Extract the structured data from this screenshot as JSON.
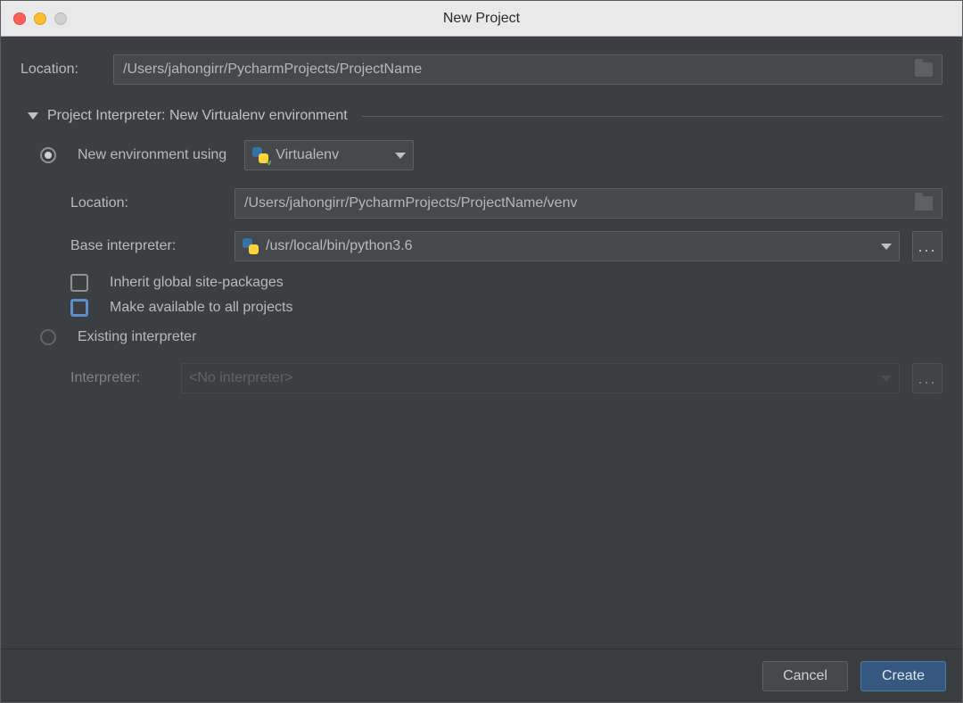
{
  "window": {
    "title": "New Project"
  },
  "location": {
    "label": "Location:",
    "value": "/Users/jahongirr/PycharmProjects/ProjectName"
  },
  "interpreter_section": {
    "title": "Project Interpreter: New Virtualenv environment"
  },
  "new_env": {
    "radio_label": "New environment using",
    "tool": "Virtualenv",
    "location_label": "Location:",
    "location_value": "/Users/jahongirr/PycharmProjects/ProjectName/venv",
    "base_label": "Base interpreter:",
    "base_value": "/usr/local/bin/python3.6",
    "inherit_label": "Inherit global site-packages",
    "all_projects_label": "Make available to all projects"
  },
  "existing": {
    "radio_label": "Existing interpreter",
    "interpreter_label": "Interpreter:",
    "interpreter_value": "<No interpreter>"
  },
  "buttons": {
    "cancel": "Cancel",
    "create": "Create"
  },
  "dots": "..."
}
